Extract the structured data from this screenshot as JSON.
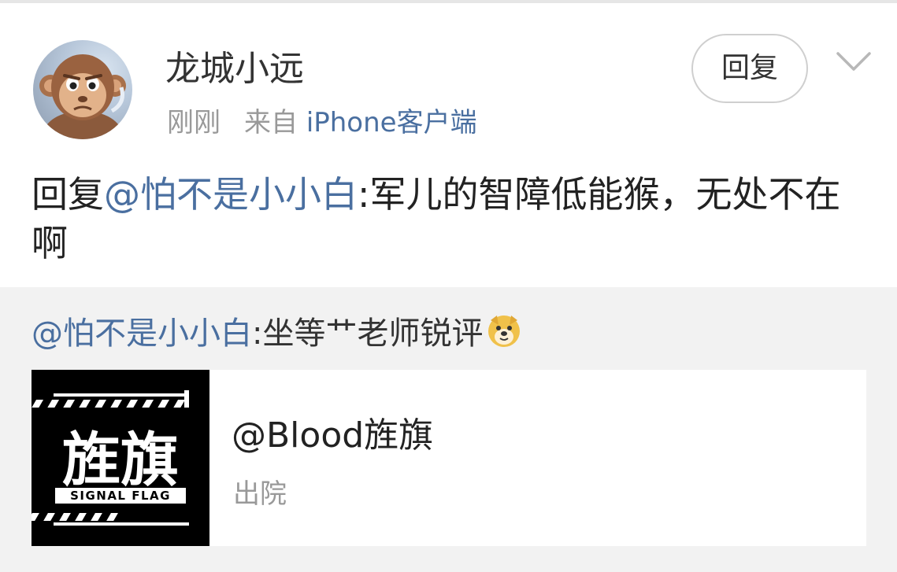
{
  "post": {
    "username": "龙城小远",
    "time": "刚刚",
    "source_prefix": "来自",
    "source_client": "iPhone客户端",
    "reply_button": "回复",
    "content": {
      "prefix": "回复",
      "mention": "@怕不是小小白",
      "text": ":军儿的智障低能猴，无处不在啊"
    }
  },
  "quote": {
    "mention": "@怕不是小小白",
    "text": ":坐等艹老师锐评",
    "emoji": "doge-emoji"
  },
  "card": {
    "title": "@Blood旌旗",
    "subtitle": "出院",
    "logo_text": "旌旗",
    "logo_caption": "SIGNAL FLAG"
  },
  "colors": {
    "link": "#4a6fa0",
    "muted": "#999999",
    "background": "#f2f2f2"
  }
}
